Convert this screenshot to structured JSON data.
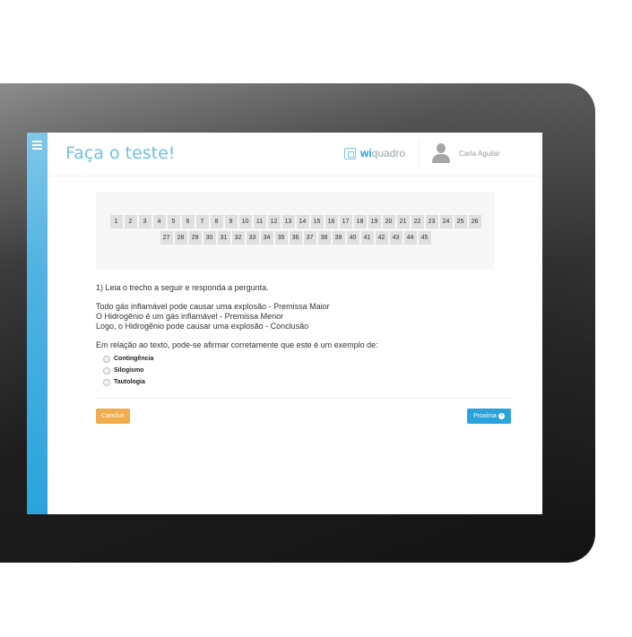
{
  "header": {
    "page_title": "Faça o teste!",
    "logo_prefix": "wi",
    "logo_suffix": "quadro",
    "user_name": "Carla Aguilar"
  },
  "question_nav": {
    "row1": [
      "1",
      "2",
      "3",
      "4",
      "5",
      "6",
      "7",
      "8",
      "9",
      "10",
      "11",
      "12",
      "13",
      "14",
      "15",
      "16",
      "17",
      "18",
      "19",
      "20",
      "21",
      "22",
      "23",
      "24",
      "25",
      "26"
    ],
    "row2": [
      "27",
      "28",
      "29",
      "30",
      "31",
      "32",
      "33",
      "34",
      "35",
      "36",
      "37",
      "38",
      "39",
      "40",
      "41",
      "42",
      "43",
      "44",
      "45"
    ]
  },
  "question": {
    "heading": "1) Leia o trecho a seguir e responda a pergunta.",
    "line1": "Todo gás inflamável pode causar uma explosão - Premissa Maior",
    "line2": "O Hidrogênio é um gás inflamável - Premissa Menor",
    "line3": "Logo, o Hidrogênio pode causar uma explosão - Conclusão",
    "prompt": "Em relação ao texto, pode-se afirmar corretamente que este é um exemplo de:",
    "options": [
      "Contingência",
      "Silogismo",
      "Tautologia"
    ]
  },
  "actions": {
    "finish_label": "Concluir",
    "next_label": "Proxima"
  },
  "icons": {
    "menu": "hamburger-icon",
    "logo": "wiquadro-logo-icon",
    "avatar": "user-avatar-icon",
    "dropdown": "chevron-down-icon",
    "next": "arrow-right-circle-icon"
  },
  "colors": {
    "accent": "#2aa3dc",
    "title": "#69c3e6",
    "finish": "#f0ad4e"
  }
}
